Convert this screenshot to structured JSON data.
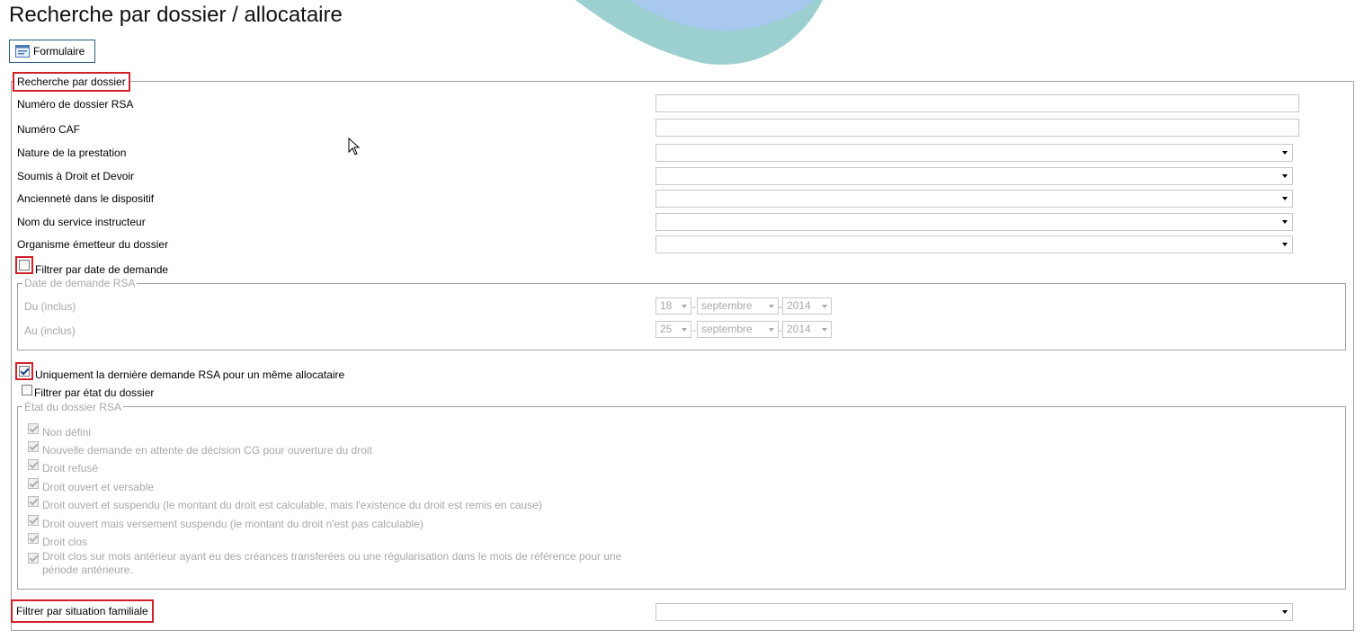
{
  "page_title": "Recherche par dossier / allocataire",
  "toolbar": {
    "form_button_label": "Formulaire",
    "form_icon": "form-icon"
  },
  "dossier_section": {
    "legend": "Recherche par dossier",
    "fields": [
      {
        "label": "Numéro de dossier RSA",
        "type": "text",
        "value": ""
      },
      {
        "label": "Numéro CAF",
        "type": "text",
        "value": ""
      },
      {
        "label": "Nature de la prestation",
        "type": "select",
        "value": ""
      },
      {
        "label": "Soumis à Droit et Devoir",
        "type": "select",
        "value": ""
      },
      {
        "label": "Ancienneté dans le dispositif",
        "type": "select",
        "value": ""
      },
      {
        "label": "Nom du service instructeur",
        "type": "select",
        "value": ""
      },
      {
        "label": "Organisme émetteur du dossier",
        "type": "select",
        "value": ""
      }
    ],
    "filter_date_label": "Filtrer par date de demande",
    "filter_date_checked": false,
    "date_fieldset": {
      "legend": "Date de demande RSA",
      "from_label": "Du (inclus)",
      "to_label": "Au (inclus)",
      "from": {
        "day": "18",
        "month": "septembre",
        "year": "2014"
      },
      "to": {
        "day": "25",
        "month": "septembre",
        "year": "2014"
      }
    },
    "last_request_label": "Uniquement la dernière demande RSA pour un même allocataire",
    "last_request_checked": true,
    "filter_state_label": "Filtrer par état du dossier",
    "filter_state_checked": false,
    "state_fieldset": {
      "legend": "État du dossier RSA",
      "options": [
        "Non défini",
        "Nouvelle demande en attente de décision CG pour ouverture du droit",
        "Droit refusé",
        "Droit ouvert et versable",
        "Droit ouvert et suspendu (le montant du droit est calculable, mais l'existence du droit est remis en cause)",
        "Droit ouvert mais versement suspendu (le montant du droit n'est pas calculable)",
        "Droit clos",
        "Droit clos sur mois antérieur ayant eu des créances transferées ou une régularisation dans le mois de référence pour une",
        "période antérieure."
      ]
    },
    "family_filter_label": "Filtrer par situation familiale",
    "family_filter_value": ""
  },
  "colors": {
    "highlight": "#d0202a",
    "disabled_text": "#a8a8a8",
    "button_border": "#2a5d80"
  }
}
